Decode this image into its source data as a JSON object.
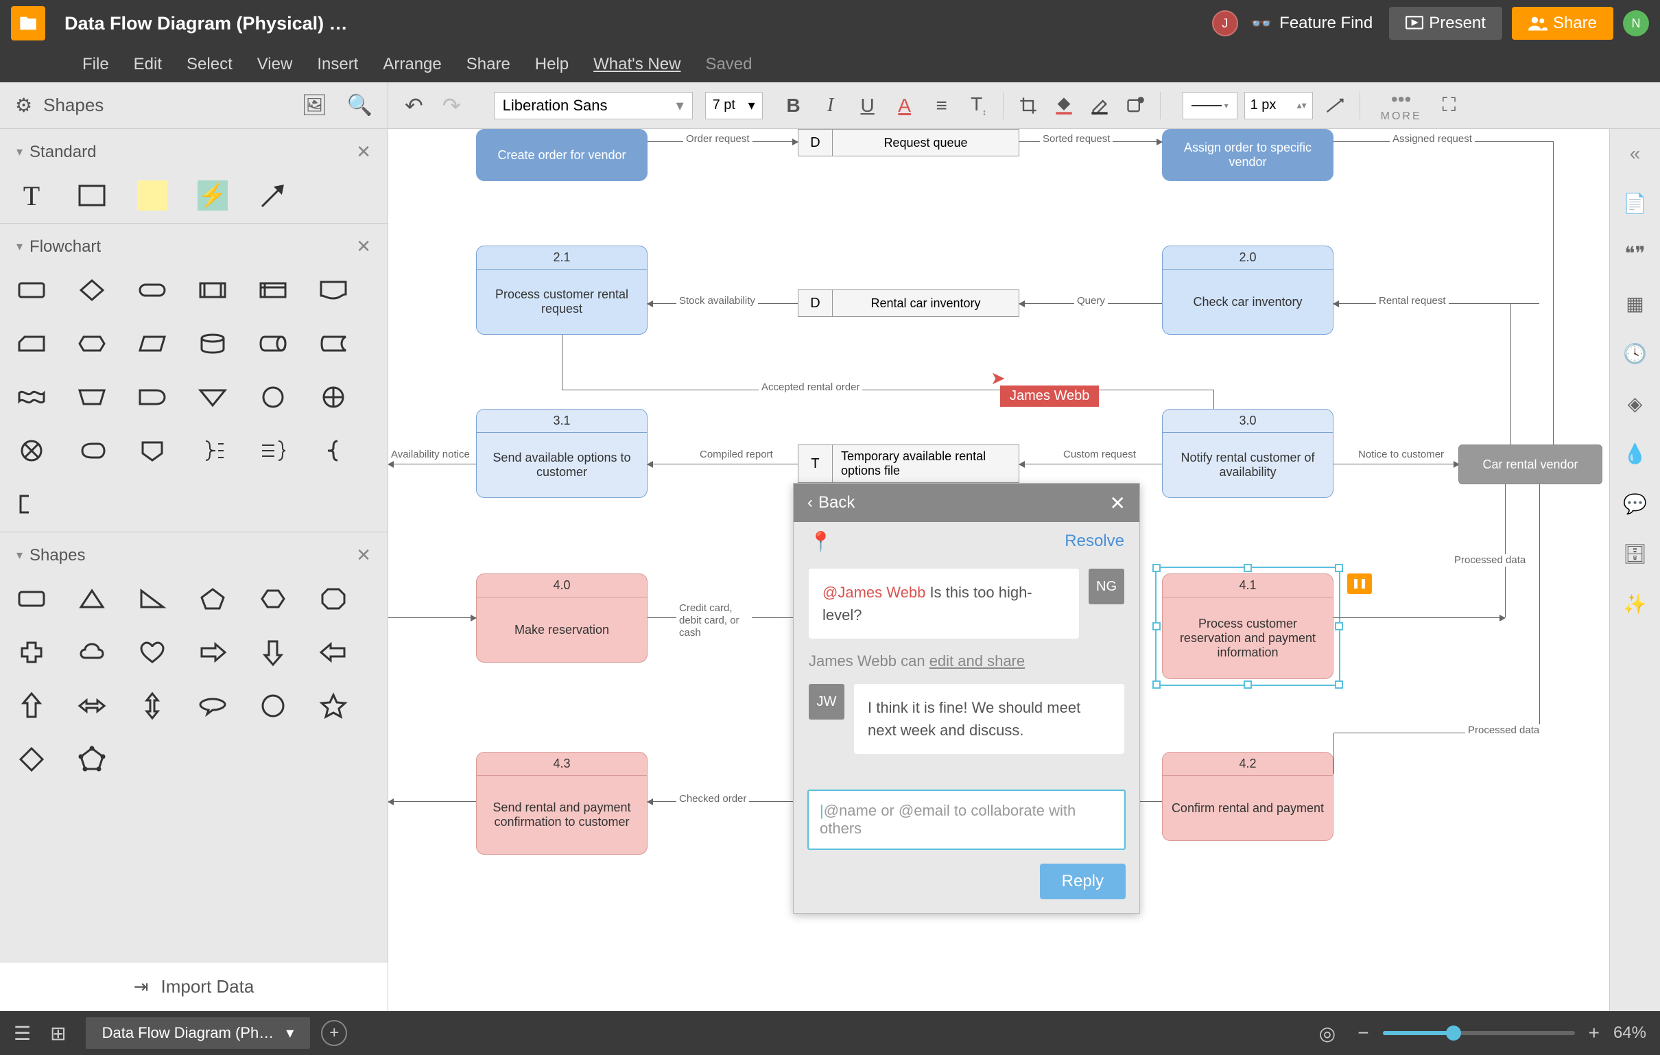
{
  "header": {
    "title": "Data Flow Diagram (Physical) …",
    "avatar1": "J",
    "avatar2": "N",
    "feature_find": "Feature Find",
    "present": "Present",
    "share": "Share"
  },
  "menubar": {
    "items": [
      "File",
      "Edit",
      "Select",
      "View",
      "Insert",
      "Arrange",
      "Share",
      "Help"
    ],
    "whats_new": "What's New",
    "saved": "Saved"
  },
  "toolbar": {
    "shapes_label": "Shapes",
    "font": "Liberation Sans",
    "size": "7 pt",
    "line_width": "1 px",
    "more": "MORE"
  },
  "left_panel": {
    "standard": "Standard",
    "flowchart": "Flowchart",
    "shapes": "Shapes",
    "import_data": "Import Data"
  },
  "diagram": {
    "nodes": {
      "create_order": "Create order for vendor",
      "assign_order": "Assign order to specific vendor",
      "n21_id": "2.1",
      "n21_label": "Process customer rental request",
      "n20_id": "2.0",
      "n20_label": "Check car inventory",
      "n31_id": "3.1",
      "n31_label": "Send available options to customer",
      "n30_id": "3.0",
      "n30_label": "Notify rental customer of availability",
      "n40_id": "4.0",
      "n40_label": "Make reservation",
      "n41_id": "4.1",
      "n41_label": "Process customer reservation and payment information",
      "n43_id": "4.3",
      "n43_label": "Send rental and payment confirmation to customer",
      "n42_id": "4.2",
      "n42_label": "Confirm rental and payment",
      "vendor": "Car rental vendor"
    },
    "datastores": {
      "d1_tag": "D",
      "d1_label": "Request queue",
      "d2_tag": "D",
      "d2_label": "Rental car inventory",
      "d3_tag": "T",
      "d3_label": "Temporary available rental options file"
    },
    "edges": {
      "order_request": "Order request",
      "sorted_request": "Sorted request",
      "assigned_request": "Assigned request",
      "stock_availability": "Stock availability",
      "query": "Query",
      "rental_request": "Rental request",
      "accepted_rental": "Accepted rental order",
      "compiled_report": "Compiled report",
      "custom_request": "Custom request",
      "notice_to_customer": "Notice to customer",
      "availability_notice": "Availability notice",
      "credit_card": "Credit card, debit card, or cash",
      "processed_data": "Processed data",
      "processed_data2": "Processed data",
      "checked_order": "Checked order"
    },
    "collab_user": "James Webb"
  },
  "comments": {
    "back": "Back",
    "resolve": "Resolve",
    "c1_avatar": "NG",
    "c1_mention": "@James Webb",
    "c1_text": " Is this too high-level?",
    "meta_name": "James Webb can ",
    "meta_link": "edit and share",
    "c2_avatar": "JW",
    "c2_text": "I think it is fine! We should meet next week and discuss.",
    "input_placeholder": "@name or @email to collaborate with others",
    "reply": "Reply"
  },
  "footer": {
    "page_tab": "Data Flow Diagram (Ph…",
    "zoom": "64%"
  }
}
